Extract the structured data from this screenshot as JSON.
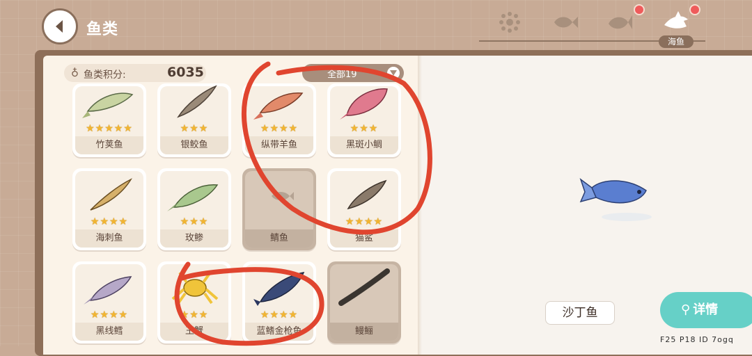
{
  "header": {
    "title": "鱼类",
    "selected_category_label": "海鱼",
    "categories": [
      {
        "name": "all-category-icon"
      },
      {
        "name": "freshwater-fish-icon"
      },
      {
        "name": "rare-fish-icon"
      },
      {
        "name": "sea-fish-icon"
      }
    ]
  },
  "score": {
    "label": "鱼类积分:",
    "value": "6035"
  },
  "filter": {
    "label": "全部19"
  },
  "cards": [
    {
      "name": "竹荚鱼",
      "stars": "★★★★★",
      "locked": false
    },
    {
      "name": "银鲛鱼",
      "stars": "★★★",
      "locked": false
    },
    {
      "name": "纵带羊鱼",
      "stars": "★★★★",
      "locked": false
    },
    {
      "name": "黑斑小鲷",
      "stars": "★★★",
      "locked": false
    },
    {
      "name": "海刺鱼",
      "stars": "★★★★",
      "locked": false
    },
    {
      "name": "玫鲹",
      "stars": "★★★",
      "locked": false
    },
    {
      "name": "鲭鱼",
      "stars": "",
      "locked": true
    },
    {
      "name": "猫鲨",
      "stars": "★★★★",
      "locked": false
    },
    {
      "name": "黑线鳕",
      "stars": "★★★★",
      "locked": false
    },
    {
      "name": "王蟹",
      "stars": "★★★",
      "locked": false
    },
    {
      "name": "蓝鳍金枪鱼",
      "stars": "★★★★",
      "locked": false
    },
    {
      "name": "鳗鲡",
      "stars": "",
      "locked": true
    }
  ],
  "selected": {
    "name": "沙丁鱼"
  },
  "details_button": {
    "label": "详情"
  },
  "footer": {
    "text": "F25 P18 ID 7ogq"
  },
  "colors": {
    "accent": "#66d0c7",
    "star": "#f2b531",
    "annotation": "#e0452f"
  }
}
